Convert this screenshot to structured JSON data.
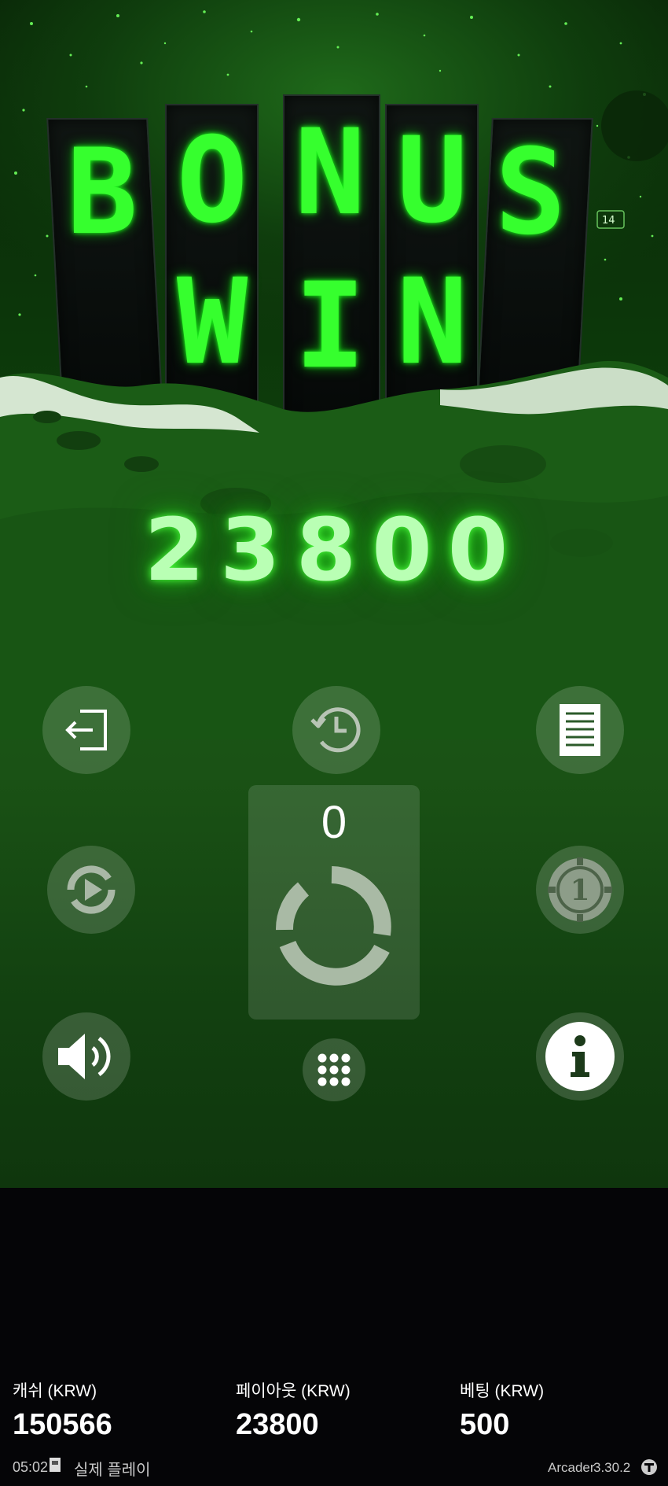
{
  "banner": {
    "top_letters": [
      "B",
      "O",
      "N",
      "U",
      "S"
    ],
    "bottom_letters": [
      "W",
      "I",
      "N"
    ]
  },
  "win_amount": "23800",
  "spin_panel": {
    "count": "0"
  },
  "buttons": {
    "exit": "exit-icon",
    "history": "history-icon",
    "paytable": "paytable-icon",
    "autoplay": "autoplay-icon",
    "bet": "bet-chip-icon",
    "sound": "sound-icon",
    "menu": "menu-grid-icon",
    "info": "info-icon",
    "spin": "spin-icon"
  },
  "stats": {
    "cash_label": "캐쉬 (KRW)",
    "cash_value": "150566",
    "payout_label": "페이아웃 (KRW)",
    "payout_value": "23800",
    "bet_label": "베팅 (KRW)",
    "bet_value": "500"
  },
  "footer": {
    "time": "05:02",
    "mode": "실제 플레이",
    "game_name": "Arcader",
    "version": "3.30.2"
  },
  "colors": {
    "neon_green": "#36ff2e",
    "background": "#050507"
  }
}
